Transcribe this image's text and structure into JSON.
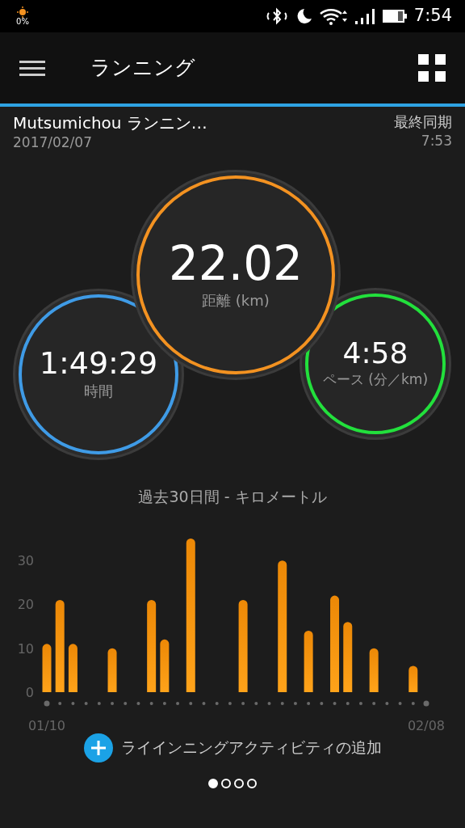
{
  "status_bar": {
    "brightness": "0%",
    "time": "7:54"
  },
  "app_bar": {
    "title": "ランニング"
  },
  "header": {
    "device": "Mutsumichou ランニン…",
    "date": "2017/02/07",
    "sync_label": "最終同期",
    "sync_time": "7:53"
  },
  "metrics": [
    {
      "value": "22.02",
      "label": "距離 (km)",
      "color": "#f39221"
    },
    {
      "value": "1:49:29",
      "label": "時間",
      "color": "#3f9be6"
    },
    {
      "value": "4:58",
      "label": "ペース (分／km)",
      "color": "#22e03c"
    }
  ],
  "chart_section": {
    "title": "過去30日間 - キロメートル",
    "chart_data": {
      "type": "bar",
      "categories": [
        "01/10",
        null,
        null,
        null,
        null,
        null,
        null,
        null,
        null,
        null,
        null,
        null,
        null,
        null,
        null,
        null,
        null,
        null,
        null,
        null,
        null,
        null,
        null,
        null,
        null,
        null,
        null,
        null,
        null,
        "02/08"
      ],
      "values": [
        11,
        21,
        11,
        0,
        0,
        10,
        0,
        0,
        21,
        12,
        0,
        35,
        0,
        0,
        0,
        21,
        0,
        0,
        30,
        0,
        14,
        0,
        22,
        16,
        0,
        10,
        0,
        0,
        6,
        0
      ],
      "yticks": [
        0,
        10,
        20,
        30
      ],
      "ylim": [
        0,
        35
      ]
    }
  },
  "add_button": {
    "label": "ライインニングアクティビティの追加"
  },
  "pages": [
    {
      "selected": true
    },
    {
      "selected": false
    },
    {
      "selected": false
    },
    {
      "selected": false
    }
  ]
}
